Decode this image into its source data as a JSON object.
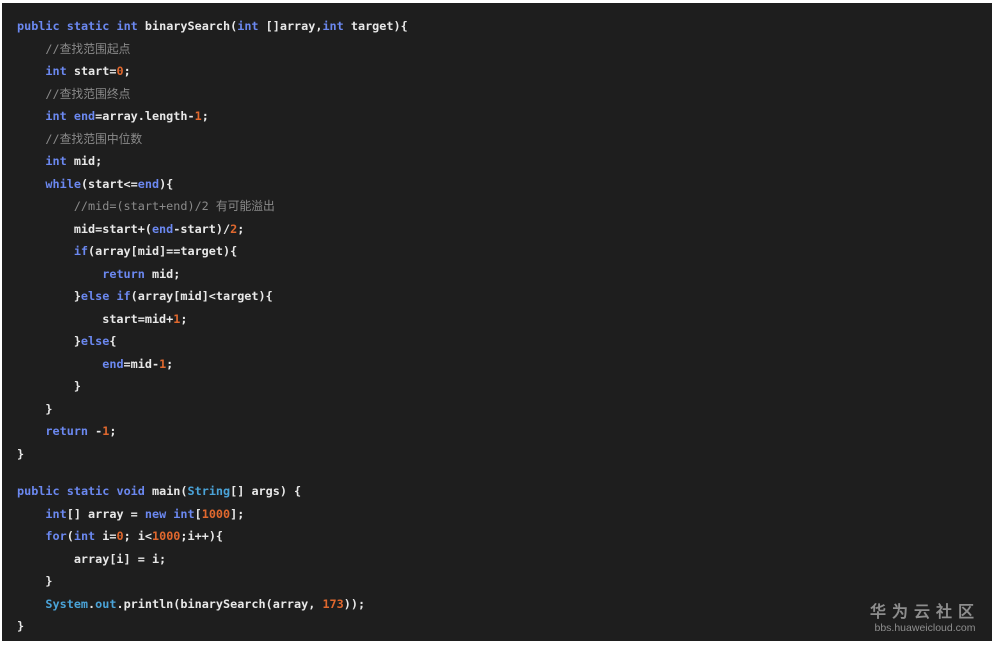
{
  "editor": {
    "background": "#1e1e1e",
    "colors": {
      "keyword": "#6b88f0",
      "class": "#4aa3d8",
      "number": "#e0682e",
      "comment": "#8a8a8a",
      "text": "#e8e8e8"
    },
    "lines": [
      [
        [
          "kw",
          "public"
        ],
        [
          "txt",
          " "
        ],
        [
          "kw",
          "static"
        ],
        [
          "txt",
          " "
        ],
        [
          "kw",
          "int"
        ],
        [
          "txt",
          " binarySearch("
        ],
        [
          "kw",
          "int"
        ],
        [
          "txt",
          " []array,"
        ],
        [
          "kw",
          "int"
        ],
        [
          "txt",
          " target){"
        ]
      ],
      [
        [
          "txt",
          "    "
        ],
        [
          "com",
          "//查找范围起点"
        ]
      ],
      [
        [
          "txt",
          "    "
        ],
        [
          "kw",
          "int"
        ],
        [
          "txt",
          " start="
        ],
        [
          "num",
          "0"
        ],
        [
          "txt",
          ";"
        ]
      ],
      [
        [
          "txt",
          "    "
        ],
        [
          "com",
          "//查找范围终点"
        ]
      ],
      [
        [
          "txt",
          "    "
        ],
        [
          "kw",
          "int"
        ],
        [
          "txt",
          " "
        ],
        [
          "kw",
          "end"
        ],
        [
          "txt",
          "=array.length-"
        ],
        [
          "num",
          "1"
        ],
        [
          "txt",
          ";"
        ]
      ],
      [
        [
          "txt",
          "    "
        ],
        [
          "com",
          "//查找范围中位数"
        ]
      ],
      [
        [
          "txt",
          "    "
        ],
        [
          "kw",
          "int"
        ],
        [
          "txt",
          " mid;"
        ]
      ],
      [
        [
          "txt",
          "    "
        ],
        [
          "kw",
          "while"
        ],
        [
          "txt",
          "(start<="
        ],
        [
          "kw",
          "end"
        ],
        [
          "txt",
          "){"
        ]
      ],
      [
        [
          "txt",
          "        "
        ],
        [
          "com",
          "//mid=(start+end)/2 有可能溢出"
        ]
      ],
      [
        [
          "txt",
          "        mid=start+("
        ],
        [
          "kw",
          "end"
        ],
        [
          "txt",
          "-start)/"
        ],
        [
          "num",
          "2"
        ],
        [
          "txt",
          ";"
        ]
      ],
      [
        [
          "txt",
          "        "
        ],
        [
          "kw",
          "if"
        ],
        [
          "txt",
          "(array[mid]==target){"
        ]
      ],
      [
        [
          "txt",
          "            "
        ],
        [
          "kw",
          "return"
        ],
        [
          "txt",
          " mid;"
        ]
      ],
      [
        [
          "txt",
          "        }"
        ],
        [
          "kw",
          "else"
        ],
        [
          "txt",
          " "
        ],
        [
          "kw",
          "if"
        ],
        [
          "txt",
          "(array[mid]<target){"
        ]
      ],
      [
        [
          "txt",
          "            start=mid+"
        ],
        [
          "num",
          "1"
        ],
        [
          "txt",
          ";"
        ]
      ],
      [
        [
          "txt",
          "        }"
        ],
        [
          "kw",
          "else"
        ],
        [
          "txt",
          "{"
        ]
      ],
      [
        [
          "txt",
          "            "
        ],
        [
          "kw",
          "end"
        ],
        [
          "txt",
          "=mid-"
        ],
        [
          "num",
          "1"
        ],
        [
          "txt",
          ";"
        ]
      ],
      [
        [
          "txt",
          "        }"
        ]
      ],
      [
        [
          "txt",
          "    }"
        ]
      ],
      [
        [
          "txt",
          "    "
        ],
        [
          "kw",
          "return"
        ],
        [
          "txt",
          " -"
        ],
        [
          "num",
          "1"
        ],
        [
          "txt",
          ";"
        ]
      ],
      [
        [
          "txt",
          "}"
        ]
      ],
      [],
      [
        [
          "kw",
          "public"
        ],
        [
          "txt",
          " "
        ],
        [
          "kw",
          "static"
        ],
        [
          "txt",
          " "
        ],
        [
          "kw",
          "void"
        ],
        [
          "txt",
          " main("
        ],
        [
          "cls",
          "String"
        ],
        [
          "txt",
          "[] args) {"
        ]
      ],
      [
        [
          "txt",
          "    "
        ],
        [
          "kw",
          "int"
        ],
        [
          "txt",
          "[] array = "
        ],
        [
          "kw",
          "new"
        ],
        [
          "txt",
          " "
        ],
        [
          "kw",
          "int"
        ],
        [
          "txt",
          "["
        ],
        [
          "num",
          "1000"
        ],
        [
          "txt",
          "];"
        ]
      ],
      [
        [
          "txt",
          "    "
        ],
        [
          "kw",
          "for"
        ],
        [
          "txt",
          "("
        ],
        [
          "kw",
          "int"
        ],
        [
          "txt",
          " i="
        ],
        [
          "num",
          "0"
        ],
        [
          "txt",
          "; i<"
        ],
        [
          "num",
          "1000"
        ],
        [
          "txt",
          ";i++){"
        ]
      ],
      [
        [
          "txt",
          "        array[i] = i;"
        ]
      ],
      [
        [
          "txt",
          "    }"
        ]
      ],
      [
        [
          "txt",
          "    "
        ],
        [
          "cls",
          "System"
        ],
        [
          "txt",
          "."
        ],
        [
          "cls",
          "out"
        ],
        [
          "txt",
          ".println(binarySearch(array, "
        ],
        [
          "num",
          "173"
        ],
        [
          "txt",
          "));"
        ]
      ],
      [
        [
          "txt",
          "}"
        ]
      ]
    ]
  },
  "watermark": {
    "title": "华为云社区",
    "url": "bbs.huaweicloud.com"
  }
}
